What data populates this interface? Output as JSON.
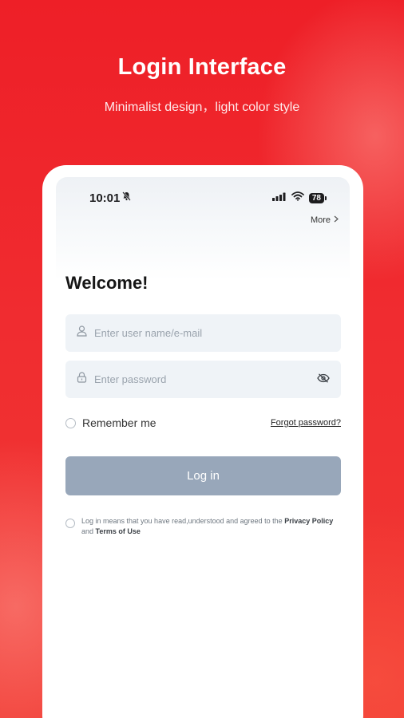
{
  "headline": {
    "title": "Login Interface",
    "subtitle": "Minimalist design，light color style"
  },
  "status_bar": {
    "time": "10:01",
    "battery": "78"
  },
  "header": {
    "more_label": "More"
  },
  "form": {
    "welcome": "Welcome!",
    "username_placeholder": "Enter user name/e-mail",
    "password_placeholder": "Enter password",
    "remember_label": "Remember me",
    "forgot_label": "Forgot password?",
    "login_label": "Log in"
  },
  "agreement": {
    "prefix": "Log in means that you have read,understood and agreed to the ",
    "privacy": "Privacy Policy",
    "and": " and ",
    "terms": "Terms of Use"
  },
  "colors": {
    "brand_red": "#ee2128",
    "button_disabled": "#98a7ba",
    "field_bg": "#eff3f7"
  },
  "icons": [
    "mute-icon",
    "signal-icon",
    "wifi-icon",
    "battery-icon",
    "chevron-right-icon",
    "user-icon",
    "lock-icon",
    "eye-off-icon"
  ]
}
